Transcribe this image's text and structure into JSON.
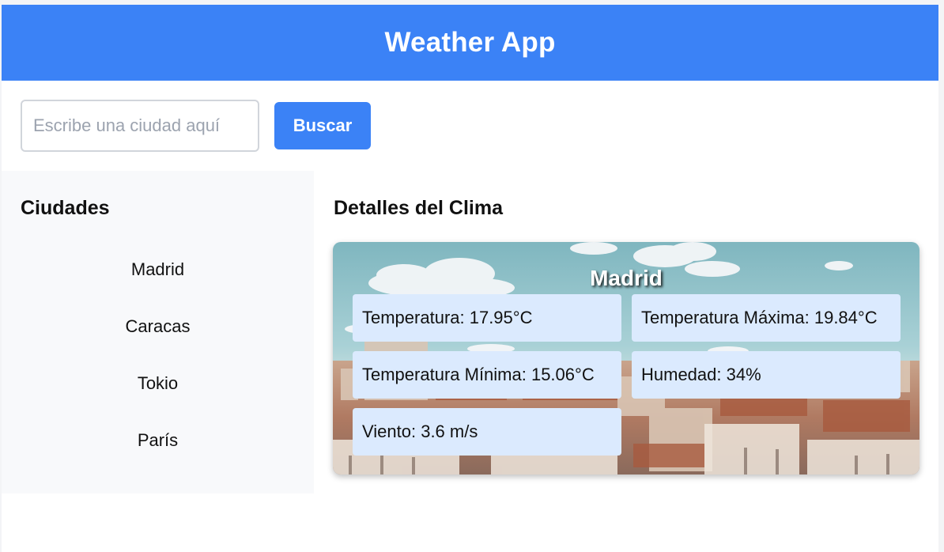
{
  "header": {
    "title": "Weather App",
    "color": "#3b82f6"
  },
  "search": {
    "placeholder": "Escribe una ciudad aquí",
    "value": "",
    "button_label": "Buscar"
  },
  "sidebar": {
    "title": "Ciudades",
    "cities": [
      "Madrid",
      "Caracas",
      "Tokio",
      "París"
    ]
  },
  "details": {
    "title": "Detalles del Clima",
    "city": "Madrid",
    "background_image": "madrid-cityscape-photo",
    "stats": {
      "temperature": "Temperatura: 17.95°C",
      "temp_max": "Temperatura Máxima: 19.84°C",
      "temp_min": "Temperatura Mínima: 15.06°C",
      "humidity": "Humedad: 34%",
      "wind": "Viento: 3.6 m/s"
    }
  }
}
